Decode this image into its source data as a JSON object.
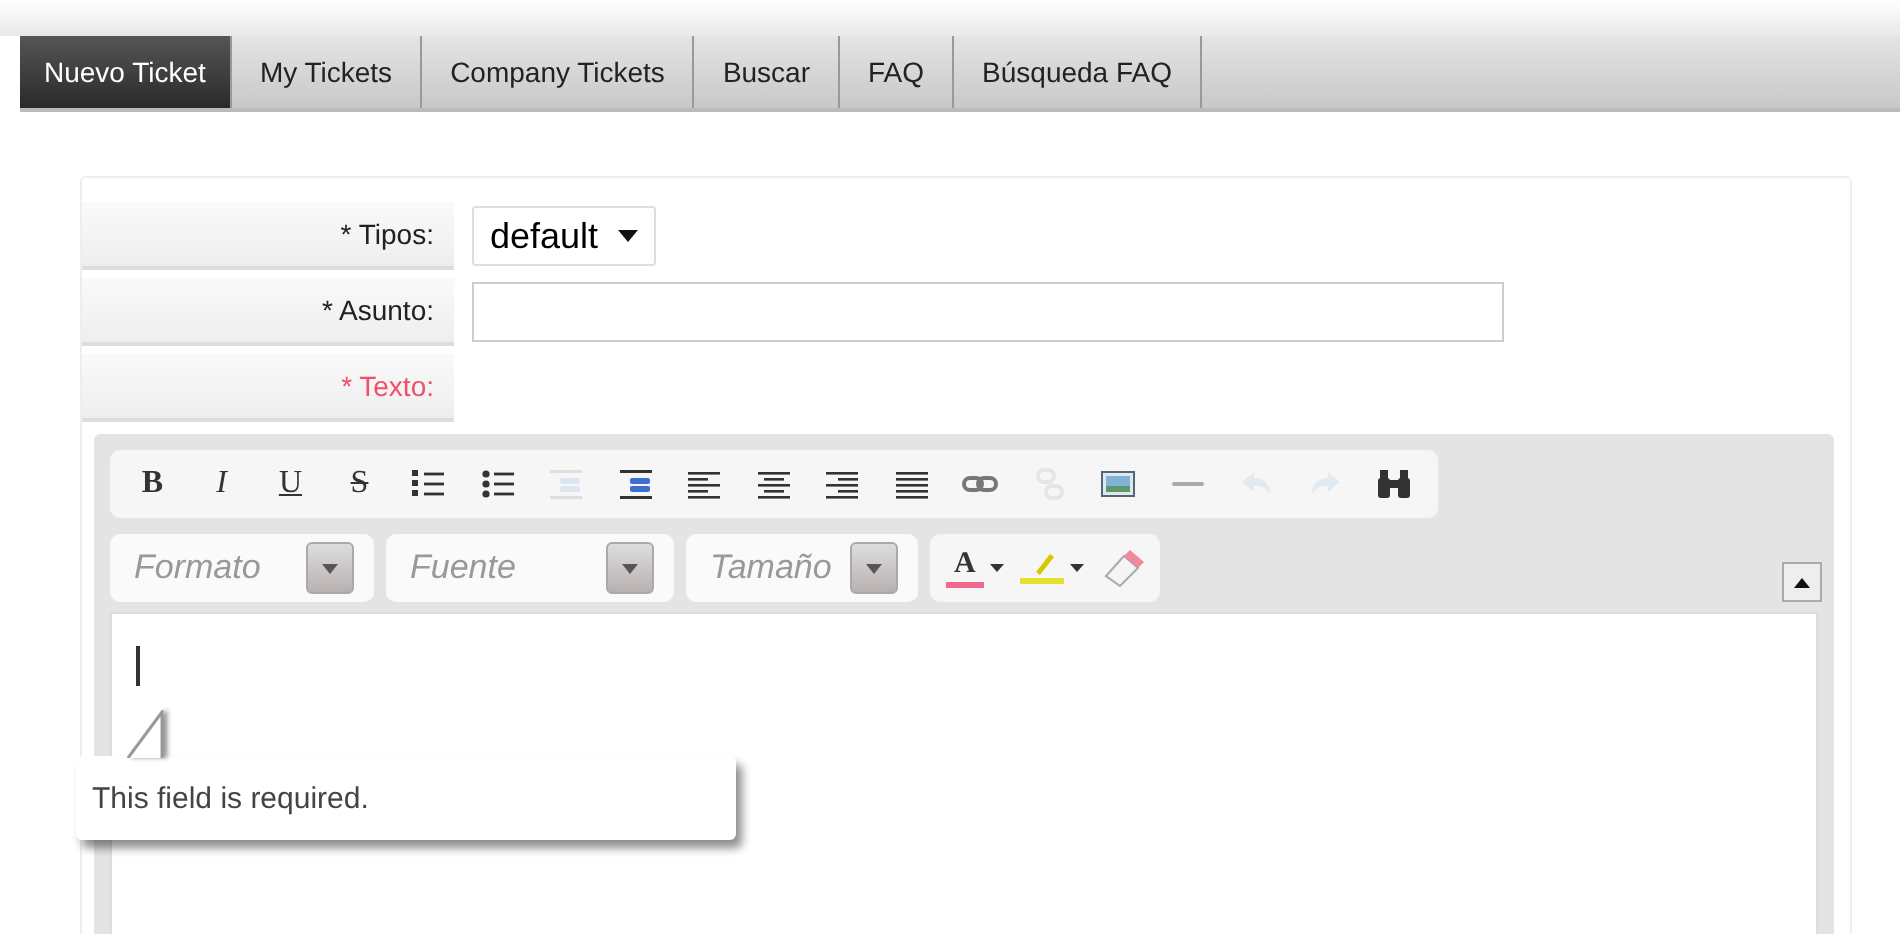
{
  "tabs": [
    {
      "label": "Nuevo Ticket",
      "selected": true
    },
    {
      "label": "My Tickets",
      "selected": false
    },
    {
      "label": "Company Tickets",
      "selected": false
    },
    {
      "label": "Buscar",
      "selected": false
    },
    {
      "label": "FAQ",
      "selected": false
    },
    {
      "label": "Búsqueda FAQ",
      "selected": false
    }
  ],
  "form": {
    "fields": [
      {
        "marker": "*",
        "label": "Tipos:",
        "kind": "select",
        "value": "default",
        "error": false
      },
      {
        "marker": "*",
        "label": "Asunto:",
        "kind": "text",
        "error": false
      },
      {
        "marker": "*",
        "label": "Texto:",
        "kind": "editor",
        "error": true
      }
    ]
  },
  "editor": {
    "toolbar": [
      {
        "kind": "bold",
        "label": "B",
        "disabled": false
      },
      {
        "kind": "italic",
        "label": "I",
        "disabled": false
      },
      {
        "kind": "underline",
        "label": "U",
        "disabled": false
      },
      {
        "kind": "strike",
        "label": "S",
        "disabled": false
      },
      {
        "kind": "ordered-list",
        "disabled": false
      },
      {
        "kind": "bullet-list",
        "disabled": false
      },
      {
        "kind": "outdent",
        "disabled": true
      },
      {
        "kind": "indent",
        "disabled": false
      },
      {
        "kind": "align-left",
        "disabled": false
      },
      {
        "kind": "align-center",
        "disabled": false
      },
      {
        "kind": "align-right",
        "disabled": false
      },
      {
        "kind": "justify",
        "disabled": false
      },
      {
        "kind": "link",
        "disabled": false
      },
      {
        "kind": "unlink",
        "disabled": true
      },
      {
        "kind": "image",
        "disabled": false
      },
      {
        "kind": "rule",
        "disabled": false
      },
      {
        "kind": "undo",
        "disabled": true
      },
      {
        "kind": "redo",
        "disabled": true
      },
      {
        "kind": "find",
        "disabled": false
      }
    ],
    "combos": [
      {
        "placeholder": "Formato"
      },
      {
        "placeholder": "Fuente"
      },
      {
        "placeholder": "Tamaño"
      }
    ],
    "text_color": {
      "label": "A"
    },
    "tooltip": "This field is required."
  }
}
